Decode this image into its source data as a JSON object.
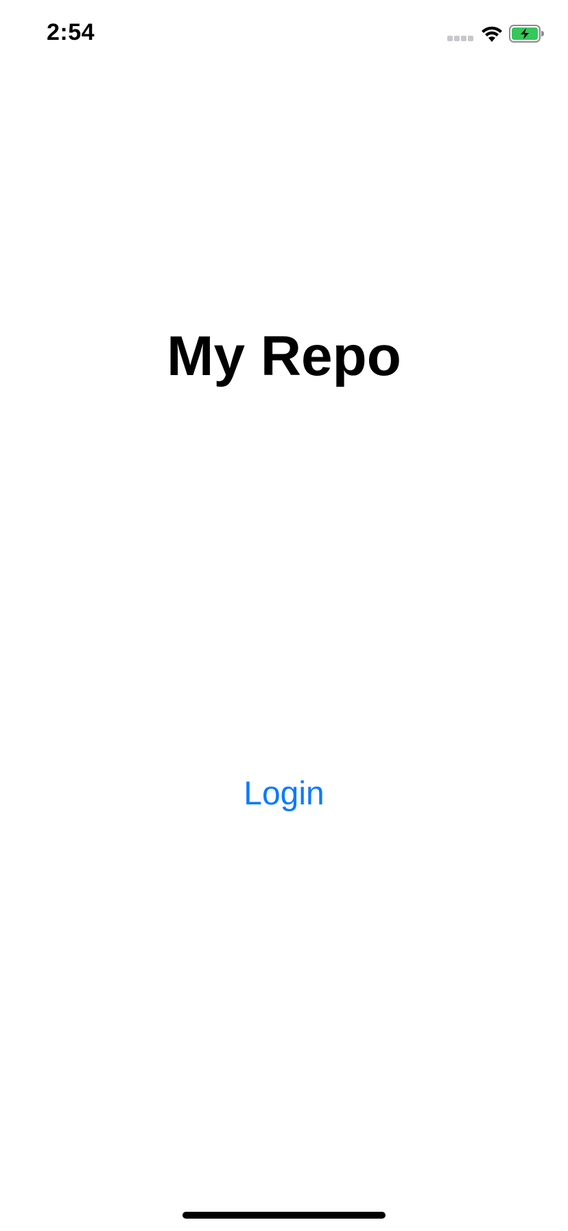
{
  "status_bar": {
    "time": "2:54",
    "signal_icon": "cellular-signal-icon",
    "wifi_icon": "wifi-icon",
    "battery_icon": "battery-charging-icon",
    "battery_color": "#34c759"
  },
  "main": {
    "title": "My Repo",
    "login_label": "Login",
    "accent_color": "#0a7aff"
  }
}
